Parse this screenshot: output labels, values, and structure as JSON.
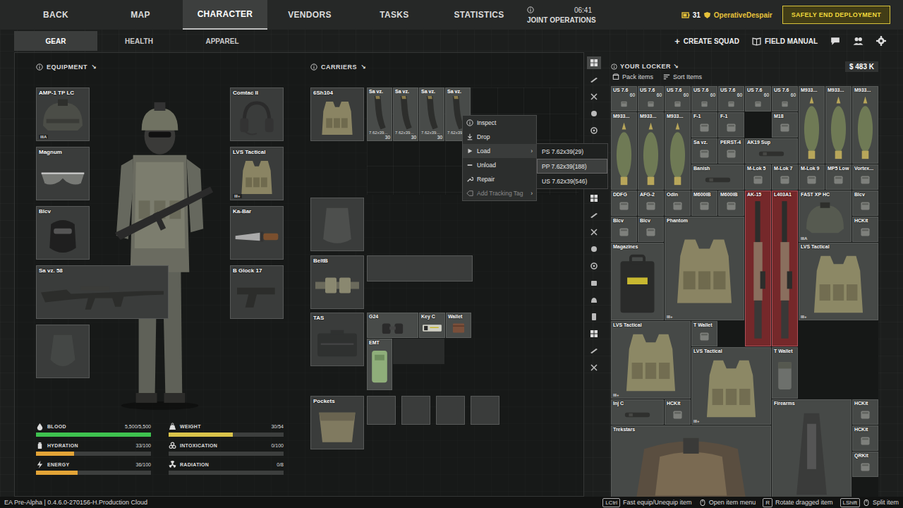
{
  "nav": {
    "tabs": [
      {
        "label": "BACK",
        "selected": false
      },
      {
        "label": "MAP",
        "selected": false
      },
      {
        "label": "CHARACTER",
        "selected": true
      },
      {
        "label": "VENDORS",
        "selected": false
      },
      {
        "label": "TASKS",
        "selected": false
      },
      {
        "label": "STATISTICS",
        "selected": false
      }
    ],
    "joint": {
      "label": "JOINT OPERATIONS",
      "timer": "06:41"
    },
    "player": {
      "level": "31",
      "name": "OperativeDespair"
    },
    "end_button": "SAFELY END DEPLOYMENT"
  },
  "subtabs": [
    {
      "label": "GEAR",
      "selected": true
    },
    {
      "label": "HEALTH",
      "selected": false
    },
    {
      "label": "APPAREL",
      "selected": false
    }
  ],
  "actions": {
    "plus": "+",
    "create_squad": "CREATE SQUAD",
    "field_manual": "FIELD MANUAL"
  },
  "equipment": {
    "title": "EQUIPMENT",
    "arrow": "↘",
    "left": [
      {
        "label": "AMP-1 TP LC",
        "kind": "helmet",
        "grade": "IIIA"
      },
      {
        "label": "Magnum",
        "kind": "glasses"
      },
      {
        "label": "Blcv",
        "kind": "mask"
      },
      {
        "label": "Sa vz. 58",
        "kind": "rifle"
      },
      {
        "kind": "empty"
      }
    ],
    "right": [
      {
        "label": "Comtac II",
        "kind": "headset"
      },
      {
        "label": "LVS Tactical",
        "kind": "vest",
        "grade": "III+"
      },
      {
        "label": "Ka-Bar",
        "kind": "knife"
      },
      {
        "label": "B Glock 17",
        "kind": "pistol"
      }
    ]
  },
  "stats": [
    {
      "label": "BLOOD",
      "value": "5,500/5,500",
      "level": 1,
      "color": "#3ec24f"
    },
    {
      "label": "WEIGHT",
      "value": "30/54",
      "level": 0.556,
      "color": "#d9c34a"
    },
    {
      "label": "HYDRATION",
      "value": "33/100",
      "level": 0.33,
      "color": "#e3a437"
    },
    {
      "label": "INTOXICATION",
      "value": "0/100",
      "level": 0,
      "color": "#3ec24f"
    },
    {
      "label": "ENERGY",
      "value": "36/100",
      "level": 0.36,
      "color": "#e3a437"
    },
    {
      "label": "RADIATION",
      "value": "0/8",
      "level": 0,
      "color": "#3ec24f"
    }
  ],
  "carriers": {
    "title": "CARRIERS",
    "arrow": "↘",
    "rig": {
      "label": "6Sh104",
      "mags": [
        {
          "label": "Sa vz.",
          "ammo": "7.62x39...",
          "count": "30"
        },
        {
          "label": "Sa vz.",
          "ammo": "7.62x39...",
          "count": "30"
        },
        {
          "label": "Sa vz.",
          "ammo": "7.62x39...",
          "count": "30"
        },
        {
          "label": "Sa vz.",
          "ammo": "7.62x39...",
          "count": "30"
        }
      ]
    },
    "belt": {
      "label": "BeltB"
    },
    "tas": {
      "label": "TAS",
      "items": [
        {
          "label": "EMT",
          "kind": "medkit"
        },
        {
          "label": "G24",
          "kind": "binocular"
        },
        {
          "label": "Key C",
          "kind": "keycard"
        },
        {
          "label": "Wallet",
          "kind": "wallet"
        }
      ]
    },
    "pockets": {
      "label": "Pockets",
      "slots": [
        {
          "filled": false
        },
        {
          "filled": false
        },
        {
          "filled": false
        },
        {
          "filled": false
        }
      ]
    }
  },
  "context_menu": {
    "items": [
      {
        "label": "Inspect",
        "kind": "info",
        "selected": false,
        "disabled": false
      },
      {
        "label": "Drop",
        "kind": "drop",
        "selected": false,
        "disabled": false
      },
      {
        "label": "Load",
        "kind": "load",
        "arrow": "›",
        "selected": true,
        "disabled": false
      },
      {
        "label": "Unload",
        "kind": "unload",
        "selected": false,
        "disabled": false
      },
      {
        "label": "Repair",
        "kind": "repair",
        "selected": false,
        "disabled": false
      },
      {
        "label": "Add Tracking Tag",
        "kind": "tag",
        "arrow": "›",
        "selected": false,
        "disabled": true
      }
    ],
    "load_menu": [
      {
        "label": "PS 7.62x39(29)",
        "selected": false
      },
      {
        "label": "PP 7.62x39(188)",
        "selected": true
      },
      {
        "label": "US 7.62x39(546)",
        "selected": false
      }
    ]
  },
  "filters": [
    {
      "selected": true
    },
    {
      "selected": false
    },
    {
      "selected": false
    },
    {
      "selected": false
    },
    {
      "selected": false
    },
    {
      "selected": false
    },
    {
      "selected": false
    },
    {
      "selected": false
    },
    {
      "selected": false
    },
    {
      "selected": false
    },
    {
      "selected": false
    },
    {
      "selected": false
    },
    {
      "selected": false
    },
    {
      "selected": false
    },
    {
      "selected": false
    },
    {
      "selected": false
    },
    {
      "selected": false
    },
    {
      "selected": false
    },
    {
      "selected": false
    }
  ],
  "locker": {
    "title": "YOUR LOCKER",
    "arrow": "↘",
    "money": "$ 483 K",
    "pack": "Pack items",
    "sort": "Sort Items",
    "items": [
      {
        "label": "US 7.6",
        "count": "60",
        "kind": "small",
        "highlighted": false
      },
      {
        "label": "US 7.6",
        "count": "60",
        "kind": "small",
        "highlighted": false
      },
      {
        "label": "US 7.6",
        "count": "60",
        "kind": "small",
        "highlighted": false
      },
      {
        "label": "US 7.6",
        "count": "60",
        "kind": "small",
        "highlighted": false
      },
      {
        "label": "US 7.6",
        "count": "60",
        "kind": "small",
        "highlighted": false
      },
      {
        "label": "US 7.6",
        "count": "60",
        "kind": "small",
        "highlighted": false
      },
      {
        "label": "US 7.6",
        "count": "60",
        "kind": "small",
        "highlighted": false
      },
      {
        "label": "M933...",
        "kind": "tall",
        "highlighted": false
      },
      {
        "label": "M933...",
        "kind": "tall",
        "highlighted": false
      },
      {
        "label": "M933...",
        "kind": "tall",
        "highlighted": false
      },
      {
        "label": "M933...",
        "kind": "tall",
        "highlighted": false
      },
      {
        "label": "M933...",
        "kind": "tall",
        "highlighted": false
      },
      {
        "label": "M933...",
        "kind": "tall",
        "highlighted": false
      },
      {
        "label": "F-1",
        "kind": "small",
        "highlighted": false
      },
      {
        "label": "F-1",
        "kind": "small",
        "highlighted": false
      },
      {
        "label": "M18",
        "kind": "small",
        "highlighted": false
      },
      {
        "label": "Sa vz.",
        "kind": "small",
        "highlighted": false
      },
      {
        "label": "PERST-4",
        "kind": "small",
        "highlighted": false
      },
      {
        "label": "AK19 Sup",
        "kind": "wide",
        "highlighted": false
      },
      {
        "label": "Banish",
        "kind": "wide",
        "highlighted": false
      },
      {
        "label": "M-Lok 5",
        "kind": "small",
        "highlighted": false
      },
      {
        "label": "M-Lok 7",
        "kind": "small",
        "highlighted": false
      },
      {
        "label": "M-Lok 9",
        "kind": "small",
        "highlighted": false
      },
      {
        "label": "MP5 Low",
        "kind": "small",
        "highlighted": false
      },
      {
        "label": "Vortex...",
        "kind": "small",
        "highlighted": false
      },
      {
        "label": "DDFG",
        "kind": "small",
        "highlighted": false
      },
      {
        "label": "AFG-2",
        "kind": "small",
        "highlighted": false
      },
      {
        "label": "Odin",
        "kind": "small",
        "highlighted": false
      },
      {
        "label": "M600IB",
        "kind": "small",
        "highlighted": false
      },
      {
        "label": "M600IB",
        "kind": "small",
        "highlighted": false
      },
      {
        "label": "AK-15",
        "kind": "rifle",
        "highlighted": true
      },
      {
        "label": "L403A1",
        "kind": "rifle",
        "highlighted": true
      },
      {
        "label": "FAST XP HC",
        "kind": "square",
        "grade": "IIIA",
        "highlighted": false
      },
      {
        "label": "Blcv",
        "kind": "small",
        "highlighted": false
      },
      {
        "label": "Blcv",
        "kind": "small",
        "highlighted": false
      },
      {
        "label": "Blcv",
        "kind": "small",
        "highlighted": false
      },
      {
        "label": "Phantom",
        "kind": "armor",
        "grade": "III+",
        "highlighted": false
      },
      {
        "label": "HCKit",
        "kind": "small",
        "highlighted": false
      },
      {
        "label": "Magazines",
        "kind": "case",
        "highlighted": false
      },
      {
        "label": "LVS Tactical",
        "kind": "vest",
        "grade": "III+",
        "highlighted": false
      },
      {
        "label": "LVS Tactical",
        "kind": "vest",
        "grade": "III+",
        "highlighted": false
      },
      {
        "label": "T Wallet",
        "kind": "small",
        "highlighted": false
      },
      {
        "label": "LVS Tactical",
        "kind": "vest",
        "grade": "III+",
        "highlighted": false
      },
      {
        "label": "T Wallet",
        "kind": "pouch",
        "highlighted": false
      },
      {
        "label": "Inj C",
        "kind": "wide",
        "highlighted": false
      },
      {
        "label": "HCKit",
        "kind": "small",
        "highlighted": false
      },
      {
        "label": "Firearms",
        "kind": "crate",
        "highlighted": false
      },
      {
        "label": "HCKit",
        "kind": "small",
        "highlighted": false
      },
      {
        "label": "Trekstars",
        "kind": "pack",
        "highlighted": false
      },
      {
        "label": "HCKit",
        "kind": "small",
        "highlighted": false
      },
      {
        "label": "QRKit",
        "kind": "small",
        "highlighted": false
      }
    ]
  },
  "footer": {
    "version": "EA Pre-Alpha | 0.4.6.0-270156-H.Production Cloud",
    "hints": [
      {
        "key": "LCtrl",
        "label": "Fast equip/Unequip item",
        "kind": "key"
      },
      {
        "label": "Open item menu",
        "kind": "mouse"
      },
      {
        "key": "R",
        "label": "Rotate dragged item",
        "kind": "key"
      },
      {
        "key": "LShift",
        "label": "Split item",
        "kind": "keymouse"
      }
    ]
  }
}
